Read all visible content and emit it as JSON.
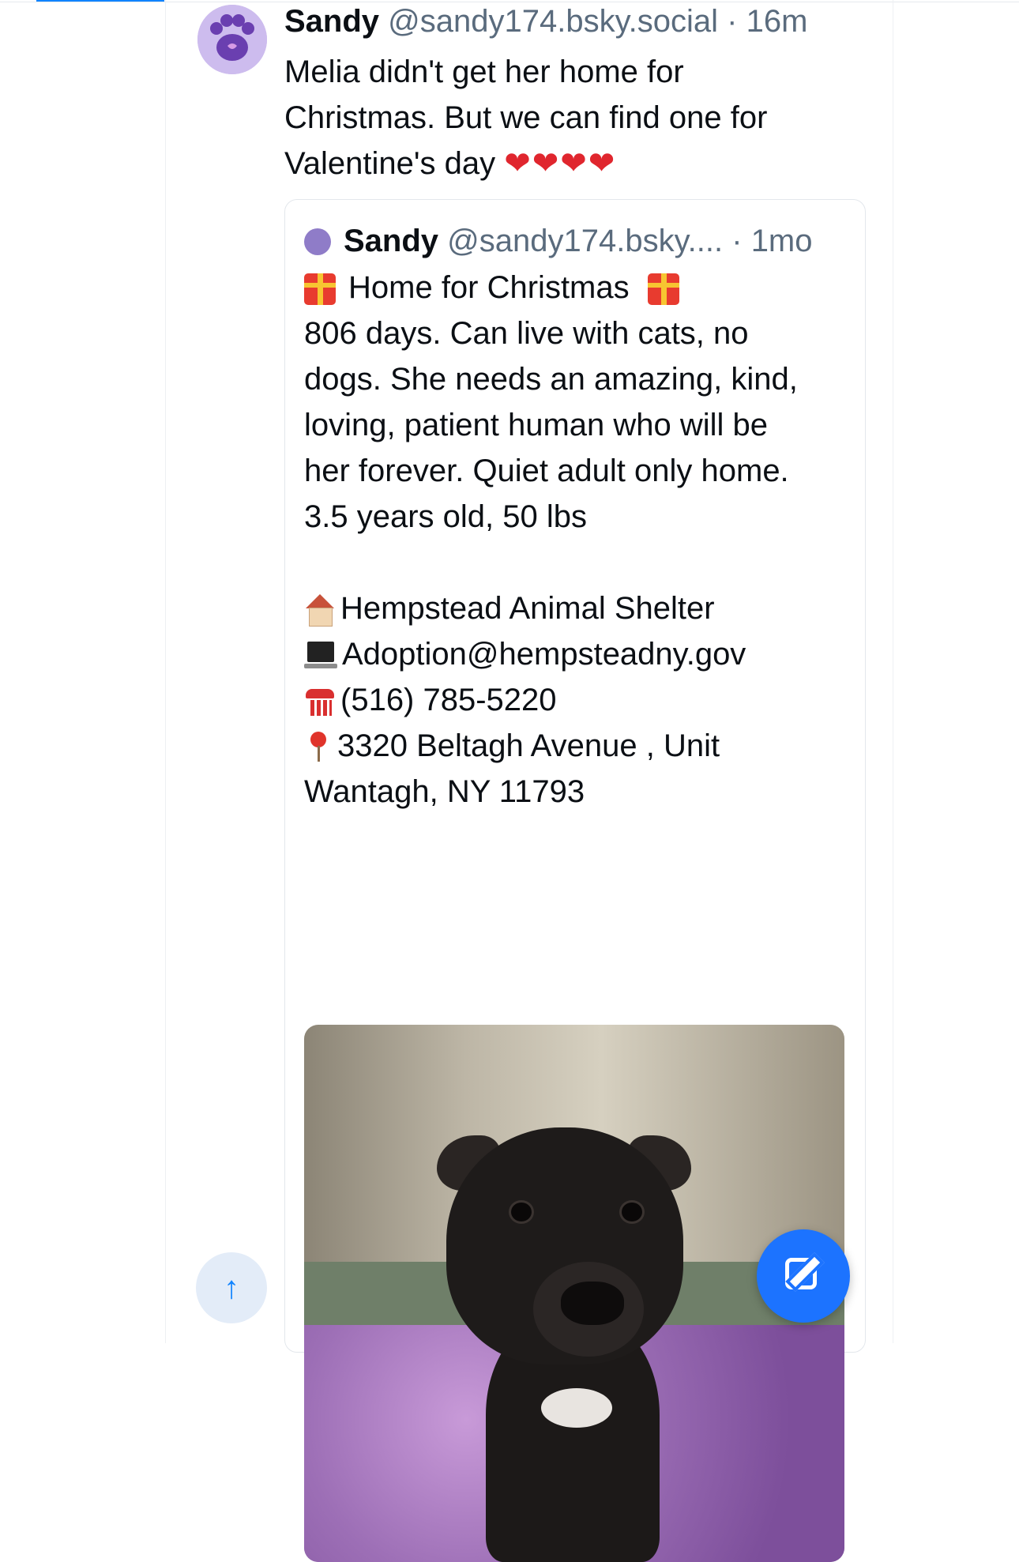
{
  "post": {
    "author_name": "Sandy",
    "author_handle": "@sandy174.bsky.social",
    "separator": "·",
    "time": "16m",
    "text_lines": [
      "Melia didn't get her home for",
      "Christmas. But we can find one for",
      "Valentine's day"
    ],
    "hearts": "❤❤❤❤",
    "avatar_icon": "paw-print-icon"
  },
  "quote": {
    "author_name": "Sandy",
    "author_handle": "@sandy174.bsky....",
    "separator": "·",
    "time": "1mo",
    "title": "Home for Christmas",
    "body_lines": [
      "806 days. Can live with cats, no",
      "dogs. She needs an amazing, kind,",
      "loving, patient human who will be",
      "her forever. Quiet adult only home.",
      "3.5 years old, 50 lbs"
    ],
    "shelter": "Hempstead Animal Shelter",
    "email": "Adoption@hempsteadny.gov",
    "phone": "(516) 785-5220",
    "address_line1": "3320 Beltagh Avenue , Unit",
    "address_line2": "Wantagh, NY 11793",
    "image_subject": "black and white dog on purple blanket in kennel"
  },
  "controls": {
    "scroll_top_symbol": "↑",
    "compose_icon": "compose-icon"
  },
  "colors": {
    "accent": "#1083fe",
    "compose": "#1c73ff",
    "muted_text": "#5a6b7d",
    "heart": "#e0262e"
  }
}
